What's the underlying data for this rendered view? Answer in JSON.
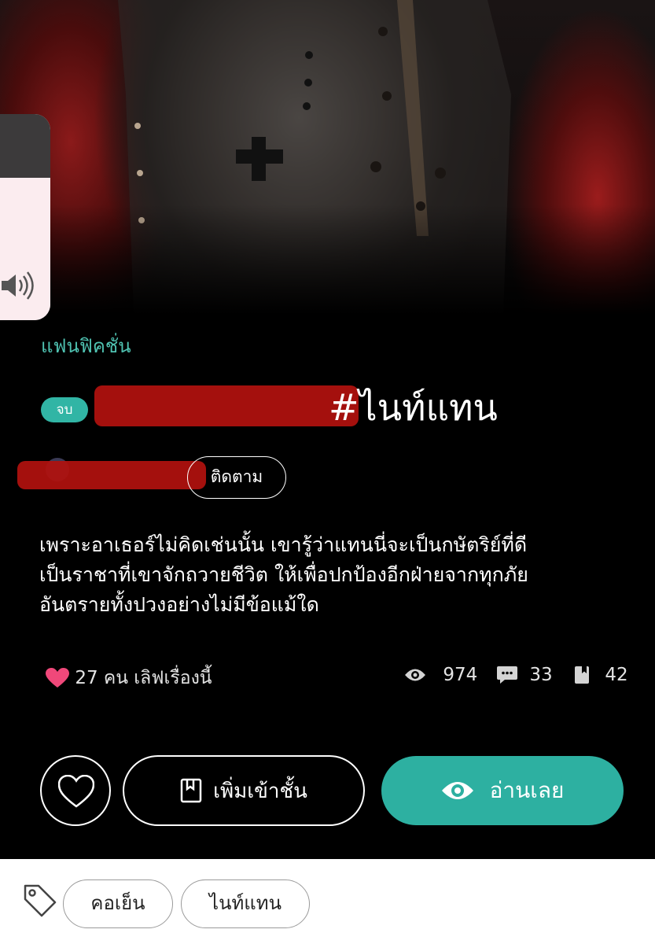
{
  "story": {
    "genre": "แฟนฟิคชั่น",
    "status_badge": "จบ",
    "title_visible": "#ไนท์แทน",
    "follow_label": "ติดตาม",
    "synopsis_lines": [
      "เพราะอาเธอร์ไม่คิดเช่นนั้น เขารู้ว่าแทนนี่จะเป็นกษัตริย์ที่ดี",
      "เป็นราชาที่เขาจักถวายชีวิต ให้เพื่อปกป้องอีกฝ่ายจากทุกภัย",
      "อันตรายทั้งปวงอย่างไม่มีข้อแม้ใด"
    ]
  },
  "stats": {
    "likes_text": "27 คน เลิฟเรื่องนี้",
    "views": "974",
    "comments": "33",
    "shelf_adds": "42"
  },
  "actions": {
    "add_shelf_label": "เพิ่มเข้าชั้น",
    "read_now_label": "อ่านเลย"
  },
  "tags": [
    "คอเย็น",
    "ไนท์แทน"
  ],
  "system": {
    "volume_level": 0.69
  },
  "colors": {
    "accent": "#2db0a1",
    "genre_text": "#4fc2b1",
    "heart": "#f0487a",
    "redaction": "#b0110e"
  },
  "icons": {
    "speaker": "speaker-icon",
    "heart": "heart-icon",
    "eye": "eye-icon",
    "comment": "comment-icon",
    "bookmark": "bookmark-icon",
    "tag": "tag-icon"
  }
}
